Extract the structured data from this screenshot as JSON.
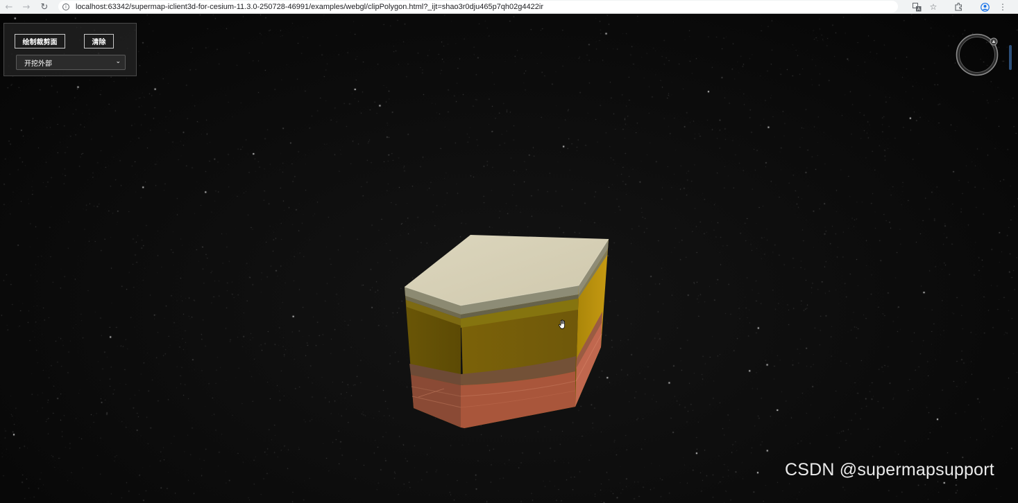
{
  "browser": {
    "url": "localhost:63342/supermap-iclient3d-for-cesium-11.3.0-250728-46991/examples/webgl/clipPolygon.html?_ijt=shao3r0dju465p7qh02g4422ir",
    "icons": {
      "back": "back-arrow-icon",
      "forward": "forward-arrow-icon",
      "reload": "reload-icon",
      "site_info": "info-icon",
      "translate": "translate-icon",
      "bookmark": "star-icon",
      "extensions": "puzzle-icon",
      "profile": "profile-icon",
      "menu": "kebab-menu-icon"
    }
  },
  "panel": {
    "draw_button_label": "绘制裁剪面",
    "clear_button_label": "清除",
    "mode_select": {
      "selected": "开挖外部"
    }
  },
  "viewer": {
    "background_color": "#0b0b0c",
    "model_layer_colors": {
      "top_surface": "#d6d0b6",
      "upper_yellow": "#8a7010",
      "mid_yellow": "#6e5908",
      "right_yellow": "#b08a0e",
      "brown_band": "#7a4f38",
      "bottom_clay": "#b0583e"
    }
  },
  "watermark": "CSDN @supermapsupport"
}
